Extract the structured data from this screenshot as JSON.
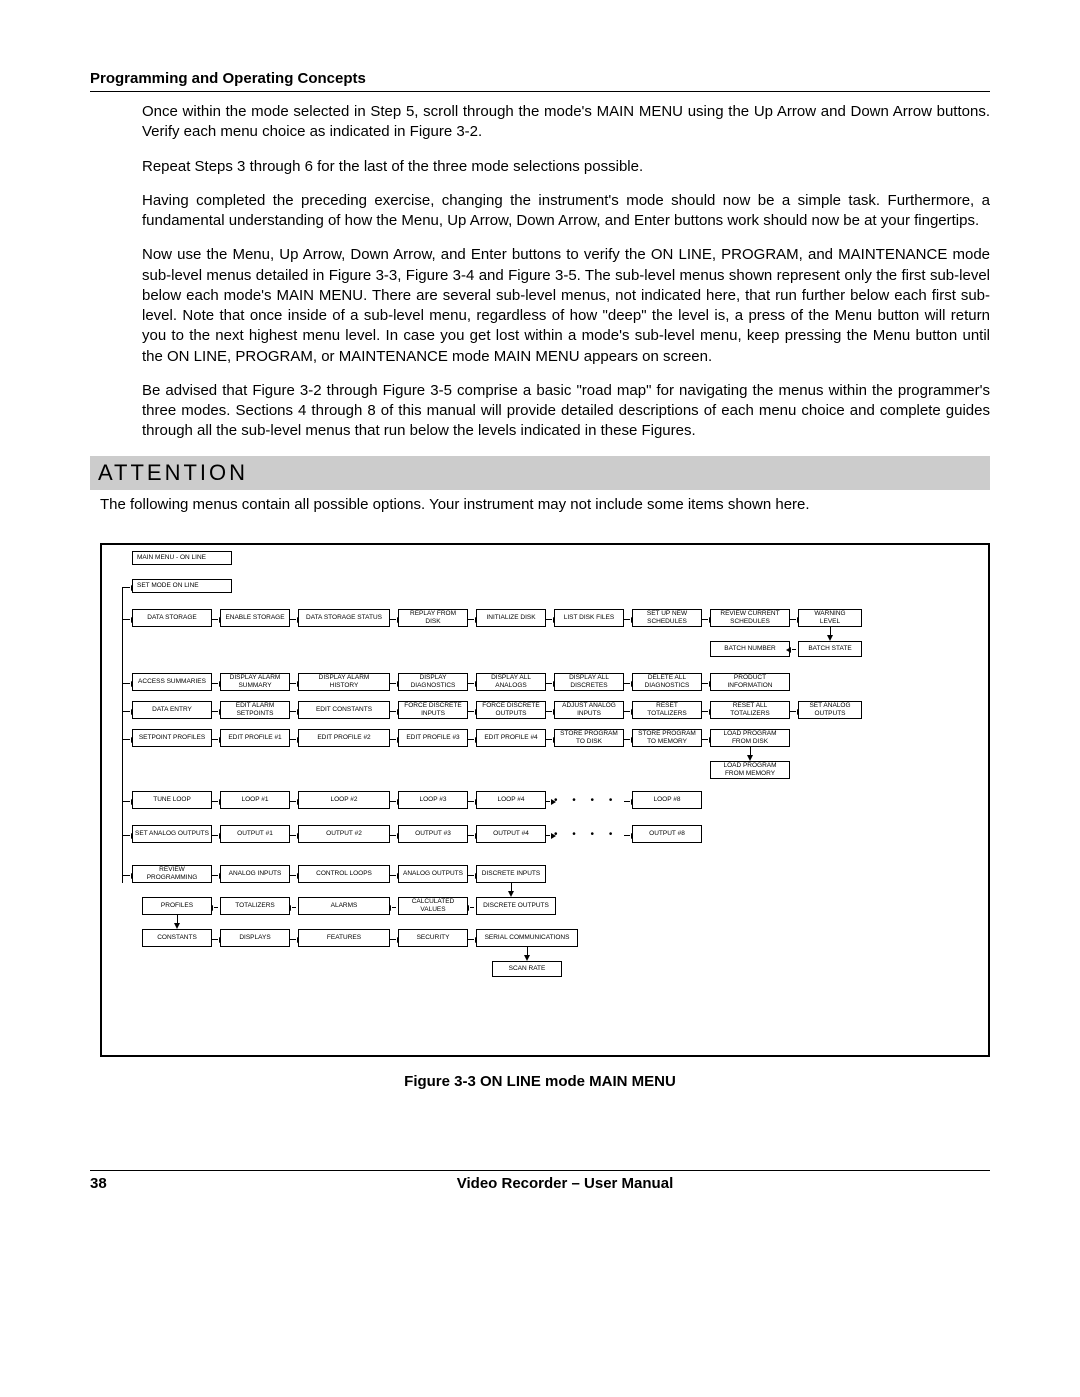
{
  "header": {
    "section_title": "Programming and Operating Concepts"
  },
  "paragraphs": {
    "p1": "Once within the mode selected in Step 5, scroll through the mode's MAIN MENU using the Up Arrow and Down Arrow buttons.  Verify each menu choice as indicated in Figure 3-2.",
    "p2": "Repeat Steps 3 through 6 for the last of the three mode selections possible.",
    "p3": "Having completed the preceding exercise, changing the instrument's mode should now be a simple task. Furthermore, a fundamental understanding of how the Menu, Up Arrow, Down Arrow, and Enter buttons work should now be at your fingertips.",
    "p4": "Now use the Menu, Up Arrow, Down Arrow, and Enter buttons to verify the ON LINE, PROGRAM, and MAINTENANCE mode sub-level menus detailed in Figure 3-3, Figure 3-4 and Figure 3-5.  The sub-level menus shown represent only the first sub-level below each mode's MAIN MENU.  There are several sub-level menus, not indicated here, that run further below each first sub-level.  Note that once inside of a sub-level menu, regardless of how \"deep\" the level is, a press of the Menu button will return you to the next highest menu level.  In case you get lost within a mode's sub-level menu, keep pressing the Menu button until the ON LINE, PROGRAM, or MAINTENANCE mode MAIN MENU appears on screen.",
    "p5": "Be advised that Figure 3-2 through Figure 3-5 comprise a basic \"road map\" for navigating the menus within the programmer's three modes.  Sections 4 through 8 of this manual will provide detailed descriptions of each menu choice and complete guides through all the sub-level menus that run below the levels indicated in these Figures."
  },
  "attention": {
    "label": "ATTENTION",
    "text": "The following menus contain all possible options.  Your instrument may not include some items shown here."
  },
  "diagram": {
    "r0": {
      "main": "MAIN MENU   -   ON LINE"
    },
    "r1": {
      "set": "SET MODE   ON LINE"
    },
    "r2": {
      "c0": "DATA STORAGE",
      "c1": "ENABLE STORAGE",
      "c2": "DATA STORAGE STATUS",
      "c3": "REPLAY FROM\nDISK",
      "c4": "INITIALIZE DISK",
      "c5": "LIST DISK FILES",
      "c6": "SET UP NEW\nSCHEDULES",
      "c7": "REVIEW CURRENT\nSCHEDULES",
      "c8": "WARNING\nLEVEL"
    },
    "r2b": {
      "c7": "BATCH NUMBER",
      "c8": "BATCH STATE"
    },
    "r3": {
      "c0": "ACCESS SUMMARIES",
      "c1": "DISPLAY ALARM\nSUMMARY",
      "c2": "DISPLAY ALARM\nHISTORY",
      "c3": "DISPLAY\nDIAGNOSTICS",
      "c4": "DISPLAY ALL\nANALOGS",
      "c5": "DISPLAY ALL\nDISCRETES",
      "c6": "DELETE ALL\nDIAGNOSTICS",
      "c7": "PRODUCT\nINFORMATION"
    },
    "r4": {
      "c0": "DATA ENTRY",
      "c1": "EDIT ALARM\nSETPOINTS",
      "c2": "EDIT CONSTANTS",
      "c3": "FORCE DISCRETE\nINPUTS",
      "c4": "FORCE DISCRETE\nOUTPUTS",
      "c5": "ADJUST ANALOG\nINPUTS",
      "c6": "RESET\nTOTALIZERS",
      "c7": "RESET ALL\nTOTALIZERS",
      "c8": "SET ANALOG\nOUTPUTS"
    },
    "r5": {
      "c0": "SETPOINT PROFILES",
      "c1": "EDIT PROFILE #1",
      "c2": "EDIT PROFILE #2",
      "c3": "EDIT PROFILE #3",
      "c4": "EDIT PROFILE #4",
      "c5": "STORE PROGRAM\nTO DISK",
      "c6": "STORE PROGRAM\nTO MEMORY",
      "c7": "LOAD PROGRAM\nFROM DISK"
    },
    "r5b": {
      "c7": "LOAD PROGRAM\nFROM MEMORY"
    },
    "r6": {
      "c0": "TUNE LOOP",
      "c1": "LOOP #1",
      "c2": "LOOP #2",
      "c3": "LOOP #3",
      "c4": "LOOP #4",
      "c6": "LOOP #8"
    },
    "r7": {
      "c0": "SET ANALOG OUTPUTS",
      "c1": "OUTPUT #1",
      "c2": "OUTPUT #2",
      "c3": "OUTPUT #3",
      "c4": "OUTPUT #4",
      "c6": "OUTPUT #8"
    },
    "r8": {
      "c0": "REVIEW PROGRAMMING",
      "c1": "ANALOG INPUTS",
      "c2": "CONTROL LOOPS",
      "c3": "ANALOG OUTPUTS",
      "c4": "DISCRETE INPUTS"
    },
    "r9": {
      "c0": "PROFILES",
      "c1": "TOTALIZERS",
      "c2": "ALARMS",
      "c3": "CALCULATED\nVALUES",
      "c4": "DISCRETE OUTPUTS"
    },
    "r10": {
      "c0": "CONSTANTS",
      "c1": "DISPLAYS",
      "c2": "FEATURES",
      "c3": "SECURITY",
      "c4": "SERIAL COMMUNICATIONS"
    },
    "r11": {
      "c4": "SCAN RATE"
    }
  },
  "figure_caption": "Figure 3-3  ON LINE mode MAIN MENU",
  "footer": {
    "page": "38",
    "title": "Video Recorder – User Manual"
  }
}
